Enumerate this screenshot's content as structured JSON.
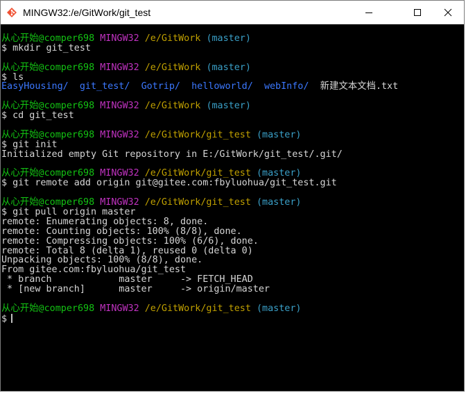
{
  "window": {
    "title": "MINGW32:/e/GitWork/git_test",
    "icon": "git-bash-icon",
    "controls": [
      "minimize-icon",
      "maximize-icon",
      "close-icon"
    ]
  },
  "terminal": {
    "colors": {
      "user": "#13c313",
      "system": "#c032c0",
      "path": "#c0a000",
      "branch": "#3aa0c8",
      "dir": "#3b78ff",
      "text": "#c0c0c0"
    },
    "blocks": [
      {
        "prompt": {
          "user": "从心开始@comper698",
          "system": "MINGW32",
          "path": "/e/GitWork",
          "branch": "(master)"
        },
        "command": "$ mkdir git_test",
        "output": []
      },
      {
        "prompt": {
          "user": "从心开始@comper698",
          "system": "MINGW32",
          "path": "/e/GitWork",
          "branch": "(master)"
        },
        "command": "$ ls",
        "ls": {
          "dirs": [
            "EasyHousing/",
            "git_test/",
            "Gotrip/",
            "helloworld/",
            "webInfo/"
          ],
          "file": "新建文本文档.txt"
        }
      },
      {
        "prompt": {
          "user": "从心开始@comper698",
          "system": "MINGW32",
          "path": "/e/GitWork",
          "branch": "(master)"
        },
        "command": "$ cd git_test",
        "output": []
      },
      {
        "prompt": {
          "user": "从心开始@comper698",
          "system": "MINGW32",
          "path": "/e/GitWork/git_test",
          "branch": "(master)"
        },
        "command": "$ git init",
        "output": [
          "Initialized empty Git repository in E:/GitWork/git_test/.git/"
        ]
      },
      {
        "prompt": {
          "user": "从心开始@comper698",
          "system": "MINGW32",
          "path": "/e/GitWork/git_test",
          "branch": "(master)"
        },
        "command": "$ git remote add origin git@gitee.com:fbyluohua/git_test.git",
        "output": []
      },
      {
        "prompt": {
          "user": "从心开始@comper698",
          "system": "MINGW32",
          "path": "/e/GitWork/git_test",
          "branch": "(master)"
        },
        "command": "$ git pull origin master",
        "output": [
          "remote: Enumerating objects: 8, done.",
          "remote: Counting objects: 100% (8/8), done.",
          "remote: Compressing objects: 100% (6/6), done.",
          "remote: Total 8 (delta 1), reused 0 (delta 0)",
          "Unpacking objects: 100% (8/8), done.",
          "From gitee.com:fbyluohua/git_test",
          " * branch            master     -> FETCH_HEAD",
          " * [new branch]      master     -> origin/master"
        ]
      },
      {
        "prompt": {
          "user": "从心开始@comper698",
          "system": "MINGW32",
          "path": "/e/GitWork/git_test",
          "branch": "(master)"
        },
        "command": "$",
        "output": []
      }
    ]
  }
}
